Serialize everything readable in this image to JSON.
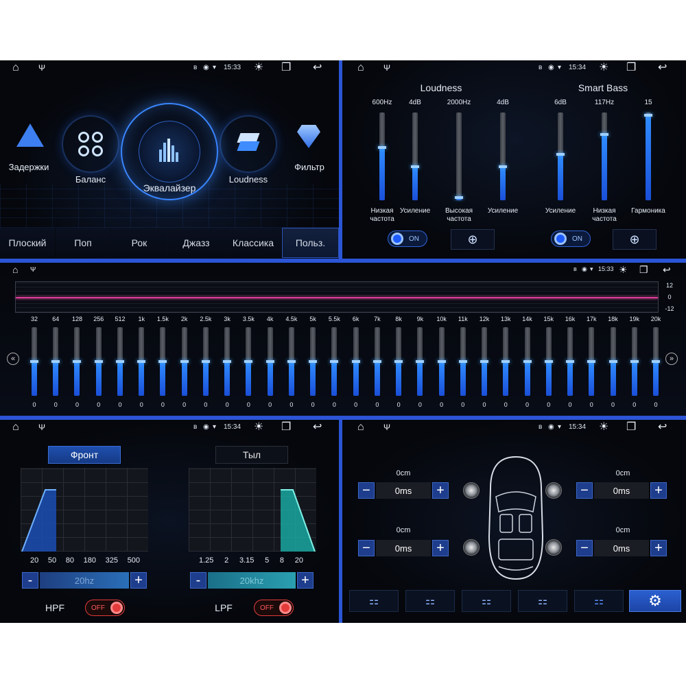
{
  "status": {
    "time_a": "15:33",
    "time_b": "15:34"
  },
  "effects": {
    "items": [
      {
        "label": "Задержки"
      },
      {
        "label": "Баланс"
      },
      {
        "label": "Эквалайзер"
      },
      {
        "label": "Loudness"
      },
      {
        "label": "Фильтр"
      }
    ],
    "presets": [
      "Плоский",
      "Поп",
      "Рок",
      "Джазз",
      "Классика",
      "Польз."
    ],
    "active_preset": "Польз."
  },
  "loudness": {
    "title": "Loudness",
    "smart_bass_title": "Smart Bass",
    "sliders": [
      {
        "value": "600Hz",
        "label": "Низкая частота",
        "level": 0.6
      },
      {
        "value": "4dB",
        "label": "Усиление",
        "level": 0.38
      },
      {
        "value": "2000Hz",
        "label": "Высокая частота",
        "level": 0.03
      },
      {
        "value": "4dB",
        "label": "Усиление",
        "level": 0.38
      },
      {
        "value": "6dB",
        "label": "Усиление",
        "level": 0.52
      },
      {
        "value": "117Hz",
        "label": "Низкая частота",
        "level": 0.75
      },
      {
        "value": "15",
        "label": "Гармоника",
        "level": 0.97
      }
    ],
    "loudness_toggle": "ON",
    "smart_bass_toggle": "ON"
  },
  "eq": {
    "scale": [
      "12",
      "0",
      "-12"
    ],
    "bands": [
      "32",
      "64",
      "128",
      "256",
      "512",
      "1k",
      "1.5k",
      "2k",
      "2.5k",
      "3k",
      "3.5k",
      "4k",
      "4.5k",
      "5k",
      "5.5k",
      "6k",
      "7k",
      "8k",
      "9k",
      "10k",
      "11k",
      "12k",
      "13k",
      "14k",
      "15k",
      "16k",
      "17k",
      "18k",
      "19k",
      "20k"
    ],
    "values": [
      "0",
      "0",
      "0",
      "0",
      "0",
      "0",
      "0",
      "0",
      "0",
      "0",
      "0",
      "0",
      "0",
      "0",
      "0",
      "0",
      "0",
      "0",
      "0",
      "0",
      "0",
      "0",
      "0",
      "0",
      "0",
      "0",
      "0",
      "0",
      "0",
      "0"
    ]
  },
  "crossover": {
    "front_label": "Фронт",
    "rear_label": "Тыл",
    "hpf_ticks": [
      "20",
      "50",
      "80",
      "180",
      "325",
      "500"
    ],
    "lpf_ticks": [
      "1.25",
      "2",
      "3.15",
      "5",
      "8",
      "20"
    ],
    "hpf_value": "20hz",
    "lpf_value": "20khz",
    "hpf_label": "HPF",
    "lpf_label": "LPF",
    "hpf_toggle": "OFF",
    "lpf_toggle": "OFF",
    "minus": "-",
    "plus": "+"
  },
  "delay": {
    "channels": [
      {
        "distance": "0cm",
        "time": "0ms"
      },
      {
        "distance": "0cm",
        "time": "0ms"
      },
      {
        "distance": "0cm",
        "time": "0ms"
      },
      {
        "distance": "0cm",
        "time": "0ms"
      }
    ]
  },
  "colors": {
    "accent": "#2b55d6",
    "eq_blue": "#2f8cff",
    "toggle_off": "#e33b3b"
  }
}
